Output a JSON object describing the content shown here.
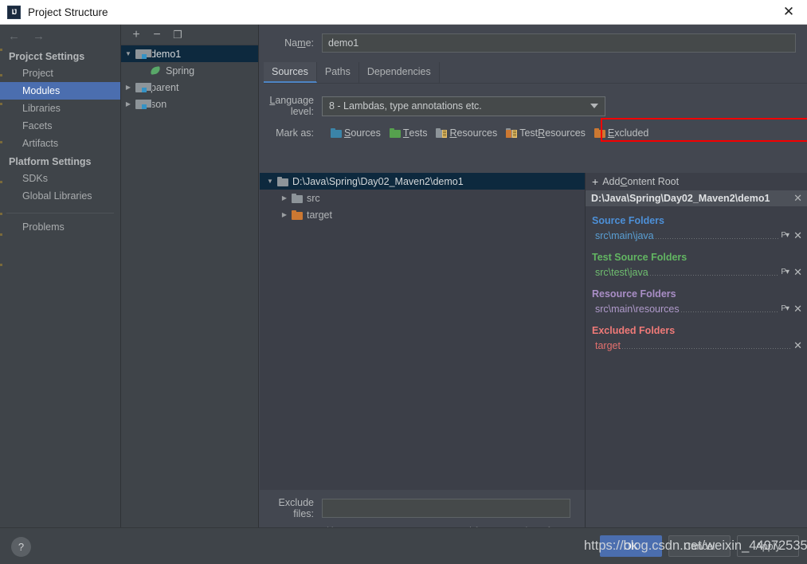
{
  "window": {
    "title": "Project Structure",
    "icon": "intellij-idea-icon",
    "close_label": "✕"
  },
  "nav": {
    "back": "←",
    "forward": "→"
  },
  "sidebar": {
    "groups": [
      {
        "label": "Projcct Settings",
        "items": [
          {
            "label": "Project",
            "selected": false
          },
          {
            "label": "Modules",
            "selected": true
          },
          {
            "label": "Libraries",
            "selected": false
          },
          {
            "label": "Facets",
            "selected": false
          },
          {
            "label": "Artifacts",
            "selected": false
          }
        ]
      },
      {
        "label": "Platform Settings",
        "items": [
          {
            "label": "SDKs",
            "selected": false
          },
          {
            "label": "Global Libraries",
            "selected": false
          }
        ]
      }
    ],
    "footer_items": [
      {
        "label": "Problems",
        "selected": false
      }
    ]
  },
  "module_toolbar": {
    "add": "+",
    "remove": "−",
    "copy": "❐"
  },
  "module_tree": [
    {
      "label": "demo1",
      "indent": 0,
      "twisty": "▼",
      "icon": "module-icon",
      "selected": true
    },
    {
      "label": "Spring",
      "indent": 1,
      "twisty": "",
      "icon": "spring-leaf-icon",
      "selected": false
    },
    {
      "label": "parent",
      "indent": 0,
      "twisty": "▶",
      "icon": "module-icon",
      "selected": false
    },
    {
      "label": "son",
      "indent": 0,
      "twisty": "▶",
      "icon": "module-icon",
      "selected": false
    }
  ],
  "main": {
    "name_label": "Na",
    "name_label_underlined": "m",
    "name_label_tail": "e:",
    "name_value": "demo1",
    "tabs": [
      {
        "label": "Sources",
        "active": true
      },
      {
        "label": "Paths",
        "active": false
      },
      {
        "label": "Dependencies",
        "active": false
      }
    ],
    "language_level_label_head": "",
    "language_level_label_underlined": "L",
    "language_level_label_tail": "anguage level:",
    "language_level_value": "8 - Lambdas, type annotations etc.",
    "mark_as_label": "Mark as:",
    "mark_as": [
      {
        "head": "",
        "key": "S",
        "tail": "ources",
        "icon": "sources-folder-icon",
        "color": "#3b84a8"
      },
      {
        "head": "",
        "key": "T",
        "tail": "ests",
        "icon": "tests-folder-icon",
        "color": "#56a14e"
      },
      {
        "head": "",
        "key": "R",
        "tail": "esources",
        "icon": "resources-folder-icon",
        "color": "#8d9499"
      },
      {
        "head": "Test ",
        "key": "R",
        "tail": "esources",
        "icon": "test-resources-folder-icon",
        "color": "#8d9499"
      },
      {
        "head": "",
        "key": "E",
        "tail": "xcluded",
        "icon": "excluded-folder-icon",
        "color": "#cc7832"
      }
    ],
    "content_tree": [
      {
        "label": "D:\\Java\\Spring\\Day02_Maven2\\demo1",
        "indent": 0,
        "twisty": "▼",
        "folder": "gray",
        "selected": true
      },
      {
        "label": "src",
        "indent": 1,
        "twisty": "▶",
        "folder": "gray",
        "selected": false
      },
      {
        "label": "target",
        "indent": 1,
        "twisty": "▶",
        "folder": "orange",
        "selected": false
      }
    ],
    "exclude_label": "Exclude files:",
    "exclude_value": "",
    "exclude_hint_1": "Use ",
    "exclude_hint_semicolon": ";",
    "exclude_hint_2": " to separate name patterns, ",
    "exclude_hint_star": "*",
    "exclude_hint_3": " for any number of symbols, ",
    "exclude_hint_question": "?",
    "exclude_hint_4": " for one."
  },
  "content_roots": {
    "add_label_head": "Add ",
    "add_label_key": "C",
    "add_label_tail": "ontent Root",
    "add_plus": "+",
    "root_path": "D:\\Java\\Spring\\Day02_Maven2\\demo1",
    "root_close": "✕",
    "groups": [
      {
        "title": "Source Folders",
        "color": "#4d90d8",
        "entries": [
          {
            "path": "src\\main\\java",
            "has_props": true,
            "props_icon": "package-prefix-icon",
            "remove_icon": "✕",
            "color": "#5a9fd4"
          }
        ]
      },
      {
        "title": "Test Source Folders",
        "color": "#62b562",
        "entries": [
          {
            "path": "src\\test\\java",
            "has_props": true,
            "props_icon": "package-prefix-icon",
            "remove_icon": "✕",
            "color": "#6fbd6f"
          }
        ]
      },
      {
        "title": "Resource Folders",
        "color": "#a98ec6",
        "entries": [
          {
            "path": "src\\main\\resources",
            "has_props": true,
            "props_icon": "package-prefix-icon",
            "remove_icon": "✕",
            "color": "#b09acb"
          }
        ]
      },
      {
        "title": "Excluded Folders",
        "color": "#f07a78",
        "entries": [
          {
            "path": "target",
            "has_props": false,
            "props_icon": "",
            "remove_icon": "✕",
            "color": "#e3706e"
          }
        ]
      }
    ]
  },
  "footer": {
    "help_label": "?",
    "buttons": [
      {
        "label": "OK",
        "style": "primary"
      },
      {
        "label": "Cancel",
        "style": "default"
      },
      {
        "label": "Apply",
        "style": "ghost"
      }
    ]
  },
  "watermark": {
    "text": "https://blog.csdn.net/weixin_44072535"
  }
}
